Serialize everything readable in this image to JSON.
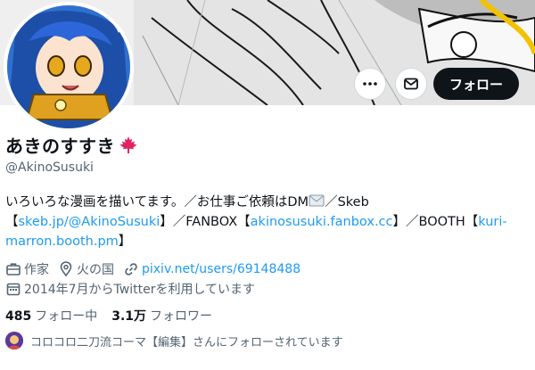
{
  "profile": {
    "display_name": "あきのすすき",
    "name_badge": "maple-leaf-icon",
    "handle": "@AkinoSusuki"
  },
  "actions": {
    "more": "more-icon",
    "message": "mail-icon",
    "follow_label": "フォロー"
  },
  "bio": {
    "line1": "いろいろな漫画を描いてます。／お仕事ご依頼はDM",
    "line1_after_icon": "／Skeb",
    "open": "【",
    "close": "】",
    "skeb_link": "skeb.jp/@AkinoSusuki",
    "fanbox_label": "／FANBOX",
    "fanbox_link": "akinosusuki.fanbox.cc",
    "booth_label": "／BOOTH",
    "booth_link_1": "kuri-",
    "booth_link_2": "marron.booth.pm"
  },
  "meta": {
    "profession": "作家",
    "location": "火の国",
    "website": "pixiv.net/users/69148488",
    "joined": "2014年7月からTwitterを利用しています"
  },
  "stats": {
    "following_count": "485",
    "following_label": "フォロー中",
    "followers_count": "3.1万",
    "followers_label": "フォロワー"
  },
  "followed_by": {
    "text": "コロコロ二刀流コーマ【編集】さんにフォローされています"
  },
  "colors": {
    "accent_link": "#1d9bf0",
    "text_primary": "#0f1419",
    "text_secondary": "#536471",
    "follow_button_bg": "#0f1419",
    "maple_red": "#e0245e"
  }
}
